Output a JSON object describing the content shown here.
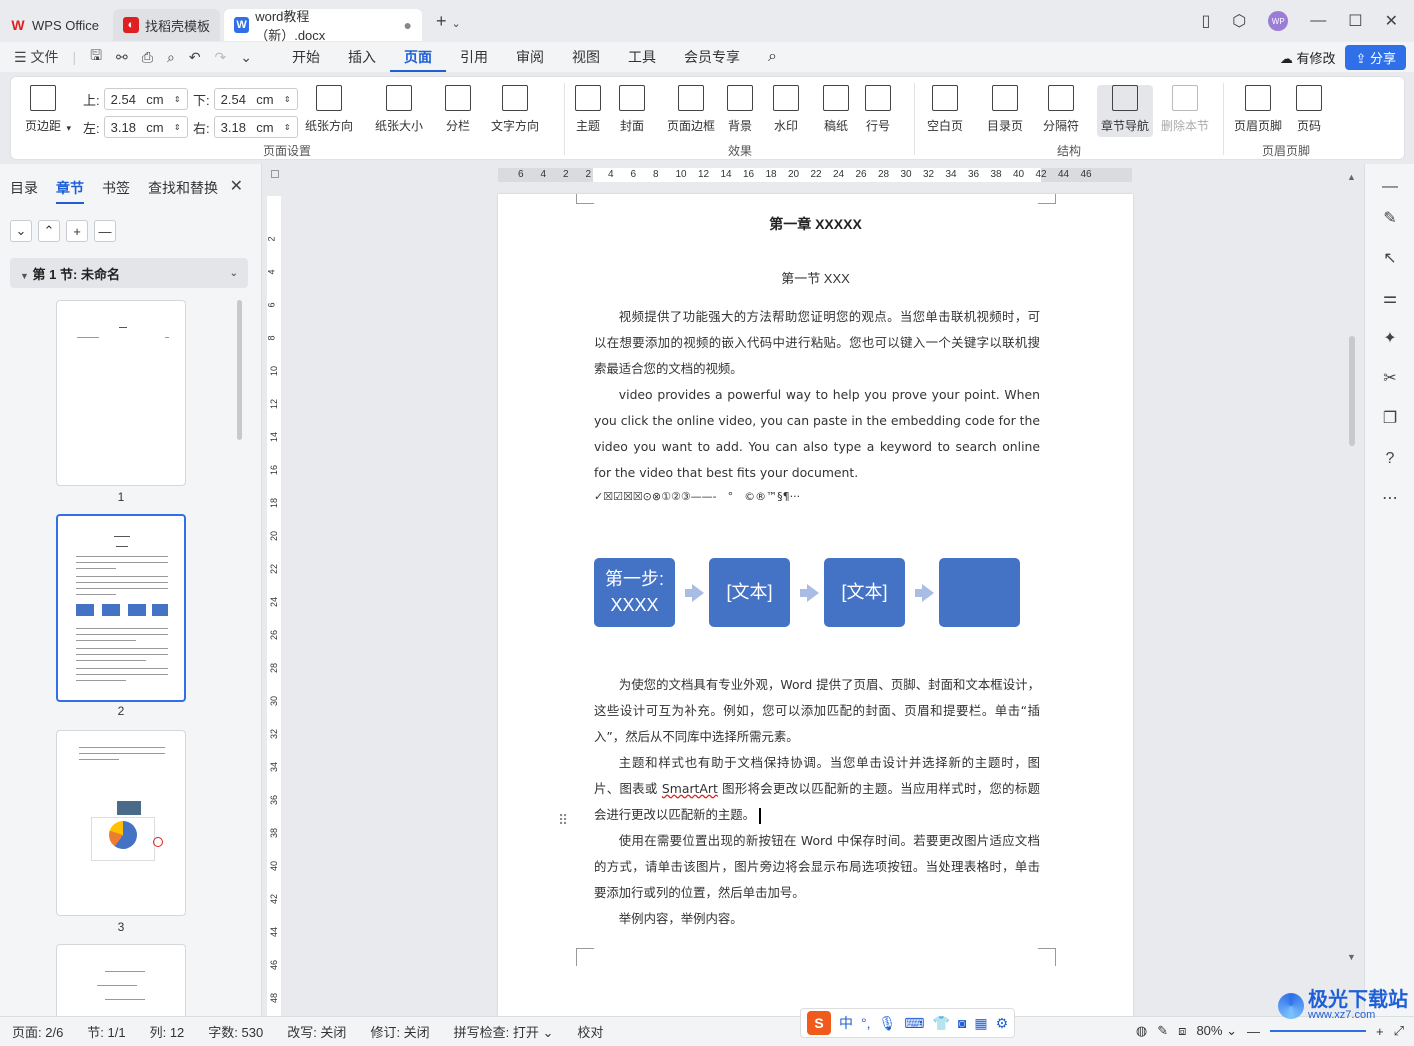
{
  "titlebar": {
    "tabs": [
      {
        "label": "WPS Office"
      },
      {
        "label": "找稻壳模板"
      },
      {
        "label": "word教程（新）.docx"
      }
    ],
    "avatar_text": "WP"
  },
  "menubar": {
    "file_label": "文件",
    "items": [
      "开始",
      "插入",
      "页面",
      "引用",
      "审阅",
      "视图",
      "工具",
      "会员专享"
    ],
    "active": "页面",
    "modified_label": "有修改",
    "share_label": "分享"
  },
  "ribbon": {
    "margins_label": "页边距",
    "top_label": "上:",
    "top_value": "2.54",
    "bottom_label": "下:",
    "bottom_value": "2.54",
    "left_label": "左:",
    "left_value": "3.18",
    "right_label": "右:",
    "right_value": "3.18",
    "unit": "cm",
    "orientation": "纸张方向",
    "size": "纸张大小",
    "columns": "分栏",
    "text_direction": "文字方向",
    "group1": "页面设置",
    "theme": "主题",
    "cover": "封面",
    "border": "页面边框",
    "background": "背景",
    "watermark": "水印",
    "grid_paper": "稿纸",
    "line_number": "行号",
    "group2": "效果",
    "blank_page": "空白页",
    "toc_page": "目录页",
    "separator": "分隔符",
    "chapter_nav": "章节导航",
    "delete_section": "删除本节",
    "group3": "结构",
    "header_footer": "页眉页脚",
    "page_number": "页码",
    "group4": "页眉页脚"
  },
  "leftpane": {
    "tabs": [
      "目录",
      "章节",
      "书签",
      "查找和替换"
    ],
    "active_tab": "章节",
    "section_title": "第 1 节: 未命名",
    "thumbs": [
      "1",
      "2",
      "3"
    ]
  },
  "hruler": [
    "6",
    "4",
    "2",
    "2",
    "4",
    "6",
    "8",
    "10",
    "12",
    "14",
    "16",
    "18",
    "20",
    "22",
    "24",
    "26",
    "28",
    "30",
    "32",
    "34",
    "36",
    "38",
    "40",
    "42",
    "44",
    "46"
  ],
  "vruler": [
    "2",
    "4",
    "6",
    "8",
    "10",
    "12",
    "14",
    "16",
    "18",
    "20",
    "22",
    "24",
    "26",
    "28",
    "30",
    "32",
    "34",
    "36",
    "38",
    "40",
    "42",
    "44",
    "46",
    "48"
  ],
  "document": {
    "chapter": "第一章  XXXXX",
    "section": "第一节  XXX",
    "para1": "视频提供了功能强大的方法帮助您证明您的观点。当您单击联机视频时，可以在想要添加的视频的嵌入代码中进行粘贴。您也可以键入一个关键字以联机搜索最适合您的文档的视频。",
    "para2": "video provides a powerful way to help you prove your point. When you click the online video, you can paste in the embedding code for the video you want to add. You can also type a keyword to search online for the video that best fits your document.",
    "symbols": "✓☒☑☒☒⊙⊗①②③——-　°　©®™§¶···",
    "steps": [
      "第一步:XXXX",
      "[文本]",
      "[文本]",
      ""
    ],
    "para3": "为使您的文档具有专业外观，Word 提供了页眉、页脚、封面和文本框设计，这些设计可互为补充。例如，您可以添加匹配的封面、页眉和提要栏。单击“插入”，然后从不同库中选择所需元素。",
    "para4a": "主题和样式也有助于文档保持协调。当您单击设计并选择新的主题时，图片、图表或 ",
    "para4_smartart": "SmartArt",
    "para4b": " 图形将会更改以匹配新的主题。当应用样式时，您的标题会进行更改以匹配新的主题。",
    "para5": "使用在需要位置出现的新按钮在 Word 中保存时间。若要更改图片适应文档的方式，请单击该图片，图片旁边将会显示布局选项按钮。当处理表格时，单击要添加行或列的位置，然后单击加号。",
    "para6": "举例内容，举例内容。"
  },
  "statusbar": {
    "page": "页面: 2/6",
    "section": "节: 1/1",
    "column": "列: 12",
    "words": "字数: 530",
    "overtype": "改写: 关闭",
    "revision": "修订: 关闭",
    "spell": "拼写检查: 打开",
    "proof": "校对",
    "zoom": "80%"
  },
  "ime": {
    "mode": "中"
  },
  "brand": {
    "name": "极光下载站",
    "url": "www.xz7.com"
  }
}
